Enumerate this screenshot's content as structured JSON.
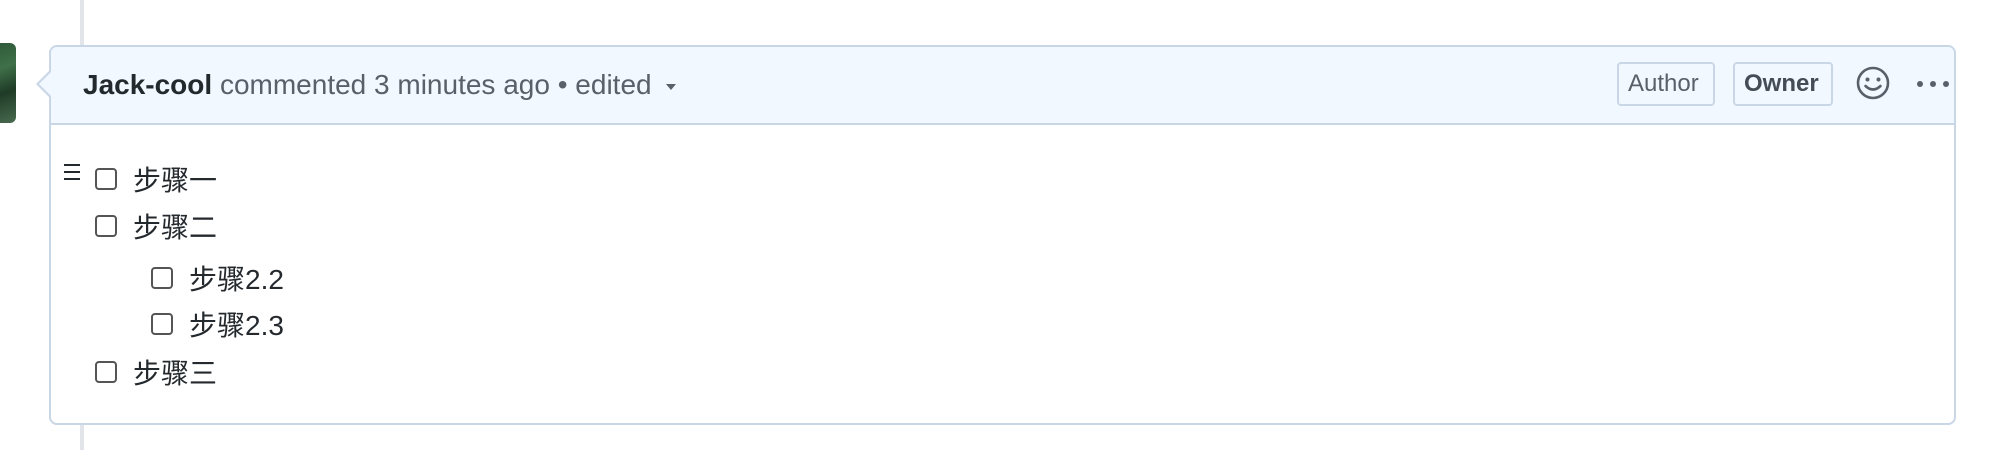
{
  "comment": {
    "author": "Jack-cool",
    "action": "commented",
    "time": "3 minutes ago",
    "separator": "•",
    "edited_label": "edited",
    "badges": {
      "author": "Author",
      "owner": "Owner"
    },
    "icons": {
      "reaction": "smiley-icon",
      "more": "kebab-horizontal-icon",
      "edited_dropdown": "triangle-down-icon",
      "drag": "grabber-icon"
    }
  },
  "tasks": [
    {
      "label": "步骤一",
      "checked": false
    },
    {
      "label": "步骤二",
      "checked": false
    },
    {
      "label": "步骤2.2",
      "checked": false
    },
    {
      "label": "步骤2.3",
      "checked": false
    },
    {
      "label": "步骤三",
      "checked": false
    }
  ],
  "colors": {
    "header_bg": "#f1f8ff",
    "border": "#c8d6e6",
    "text_primary": "#24292e",
    "text_muted": "#586069"
  }
}
